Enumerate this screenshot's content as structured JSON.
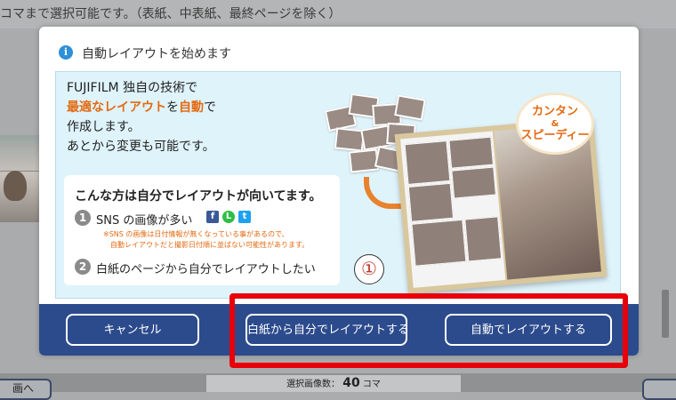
{
  "background": {
    "top_notice": "コマまで選択可能です。（表紙、中表紙、最終ページを除く）",
    "count_label": "選択画像数：",
    "count_value": "40",
    "count_unit": "コマ",
    "left_button_label": "画へ"
  },
  "modal": {
    "title": "自動レイアウトを始めます",
    "intro": {
      "line1": "FUJIFILM 独自の技術で",
      "line2_highlight1": "最適なレイアウト",
      "line2_mid": "を",
      "line2_highlight2": "自動",
      "line2_end": "で",
      "line3": "作成します。",
      "line4": "あとから変更も可能です。"
    },
    "card": {
      "title": "こんな方は自分でレイアウトが向いてます。",
      "item1_number": "1",
      "item1_text": "SNS の画像が多い",
      "sns_icons": [
        "facebook-icon",
        "line-icon",
        "twitter-icon"
      ],
      "note_line1": "※SNS の画像は日付情報が無くなっている事があるので、",
      "note_line2": "自動レイアウトだと撮影日付順に並ばない可能性があります。",
      "item2_number": "2",
      "item2_text": "白紙のページから自分でレイアウトしたい"
    },
    "badge": {
      "line1": "カンタン",
      "amp": "&",
      "line2": "スピーディー"
    },
    "marker": "①",
    "buttons": {
      "cancel": "キャンセル",
      "manual": "白紙から自分でレイアウトする",
      "auto": "自動でレイアウトする"
    }
  },
  "colors": {
    "accent_orange": "#e36a12",
    "footer_blue": "#2c4b8c",
    "highlight_red": "#e8000a",
    "panel_bg": "#dff3fb"
  }
}
